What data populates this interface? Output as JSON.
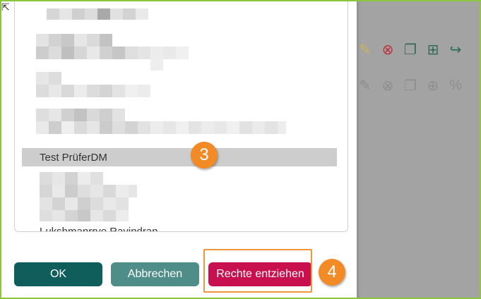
{
  "dialog": {
    "selected_user": "Test PrüferDM",
    "partial_top_label": "…",
    "partial_bottom_label": "Lukshmanrrye Ravindran"
  },
  "buttons": {
    "ok": "OK",
    "cancel": "Abbrechen",
    "revoke": "Rechte entziehen"
  },
  "annotations": {
    "step3": "3",
    "step4": "4"
  },
  "background_icons": {
    "row1": [
      "pencil-icon",
      "x-circle-icon",
      "copy-icon",
      "folder-plus-icon",
      "share-icon"
    ],
    "row2": [
      "pencil-icon",
      "x-circle-icon",
      "copy-icon",
      "comment-plus-icon",
      "percent-icon"
    ]
  },
  "colors": {
    "ok": "#0f5e5b",
    "cancel": "#4f8d88",
    "revoke": "#c8104f",
    "annotation": "#f28a26",
    "frame": "#8cc63f"
  }
}
